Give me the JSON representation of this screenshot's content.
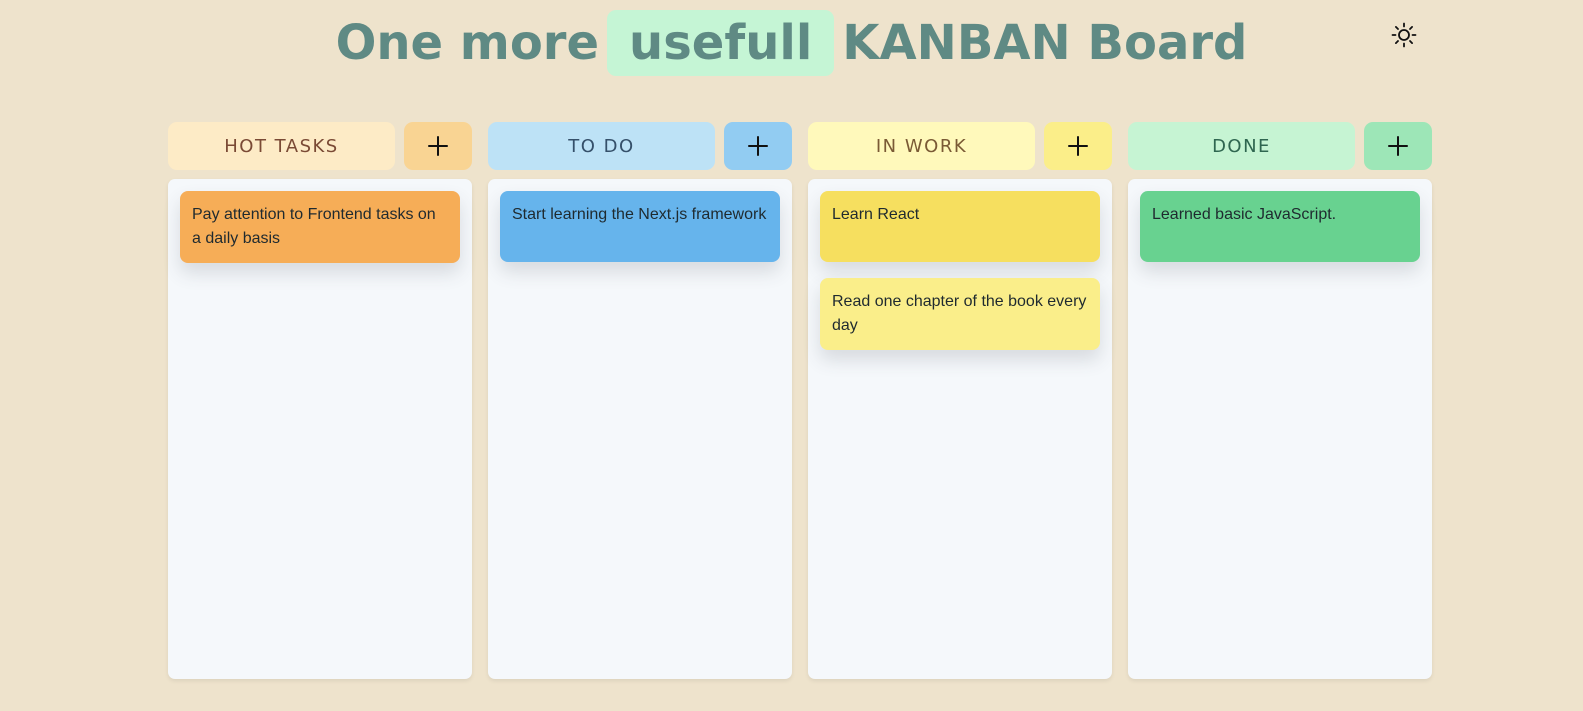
{
  "header": {
    "title_pre": "One more",
    "title_highlight": "usefull",
    "title_post": "KANBAN Board",
    "theme_icon": "sun-icon"
  },
  "colors": {
    "background": "#eee3cc",
    "title_text": "#5f8a84",
    "title_highlight": "#c5f5d5",
    "column_body": "#f5f8fb"
  },
  "columns": [
    {
      "title": "HOT TASKS",
      "title_bg": "#fdebc6",
      "title_color": "#7a4a35",
      "add_bg": "#f9d493",
      "add_icon": "plus-icon",
      "cards": [
        {
          "text": "Pay attention to Frontend tasks on a daily basis",
          "bg": "#f6ad57"
        }
      ]
    },
    {
      "title": "TO DO",
      "title_bg": "#bde2f6",
      "title_color": "#35506a",
      "add_bg": "#92ccf2",
      "add_icon": "plus-icon",
      "cards": [
        {
          "text": "Start learning the Next.js framework",
          "bg": "#66b4ec"
        }
      ]
    },
    {
      "title": "IN WORK",
      "title_bg": "#fff9bb",
      "title_color": "#7a5a35",
      "add_bg": "#fbee89",
      "add_icon": "plus-icon",
      "cards": [
        {
          "text": "Learn React",
          "bg": "#f6df5f"
        },
        {
          "text": "Read one chapter of the book every day",
          "bg": "#faee8a"
        }
      ]
    },
    {
      "title": "DONE",
      "title_bg": "#c6f4d3",
      "title_color": "#2f6650",
      "add_bg": "#9de6b7",
      "add_icon": "plus-icon",
      "cards": [
        {
          "text": "Learned basic JavaScript.",
          "bg": "#68d290"
        }
      ]
    }
  ]
}
